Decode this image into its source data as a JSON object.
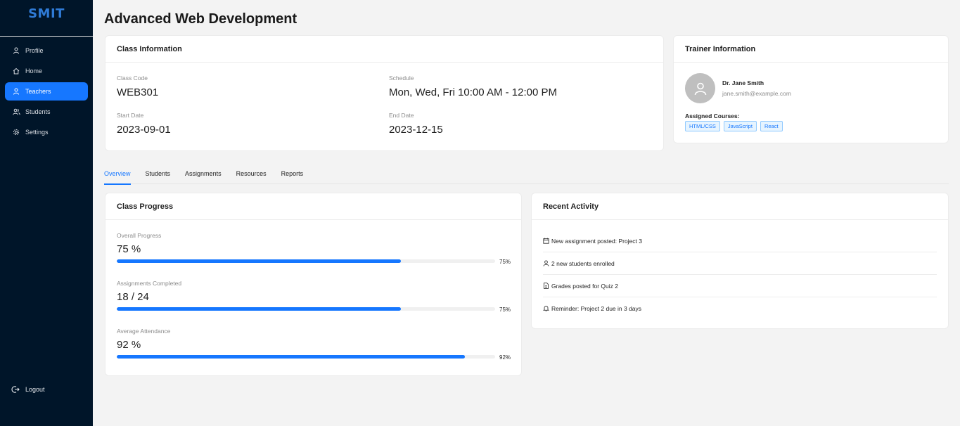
{
  "brand": {
    "logo_text": "SMIT"
  },
  "sidebar": {
    "items": [
      {
        "label": "Profile",
        "icon": "user-icon"
      },
      {
        "label": "Home",
        "icon": "home-icon"
      },
      {
        "label": "Teachers",
        "icon": "user-icon",
        "active": true
      },
      {
        "label": "Students",
        "icon": "users-icon"
      },
      {
        "label": "Settings",
        "icon": "gear-icon"
      }
    ],
    "logout_label": "Logout"
  },
  "page": {
    "title": "Advanced Web Development"
  },
  "class_info": {
    "title": "Class Information",
    "class_code_label": "Class Code",
    "class_code": "WEB301",
    "schedule_label": "Schedule",
    "schedule": "Mon, Wed, Fri 10:00 AM - 12:00 PM",
    "start_date_label": "Start Date",
    "start_date": "2023-09-01",
    "end_date_label": "End Date",
    "end_date": "2023-12-15"
  },
  "trainer": {
    "title": "Trainer Information",
    "name": "Dr. Jane Smith",
    "email": "jane.smith@example.com",
    "assigned_label": "Assigned Courses:",
    "courses": [
      "HTML/CSS",
      "JavaScript",
      "React"
    ]
  },
  "tabs": [
    {
      "label": "Overview",
      "active": true
    },
    {
      "label": "Students"
    },
    {
      "label": "Assignments"
    },
    {
      "label": "Resources"
    },
    {
      "label": "Reports"
    }
  ],
  "progress": {
    "title": "Class Progress",
    "items": [
      {
        "label": "Overall Progress",
        "value": "75 %",
        "percent": 75,
        "percent_label": "75%"
      },
      {
        "label": "Assignments Completed",
        "value": "18 / 24",
        "percent": 75,
        "percent_label": "75%"
      },
      {
        "label": "Average Attendance",
        "value": "92 %",
        "percent": 92,
        "percent_label": "92%"
      }
    ]
  },
  "activity": {
    "title": "Recent Activity",
    "items": [
      {
        "text": "New assignment posted: Project 3",
        "icon": "calendar-icon"
      },
      {
        "text": "2 new students enrolled",
        "icon": "user-icon"
      },
      {
        "text": "Grades posted for Quiz 2",
        "icon": "file-icon"
      },
      {
        "text": "Reminder: Project 2 due in 3 days",
        "icon": "bell-icon"
      }
    ]
  },
  "colors": {
    "sidebar_bg": "#001529",
    "accent": "#1677ff",
    "page_bg": "#f3f3f3"
  }
}
